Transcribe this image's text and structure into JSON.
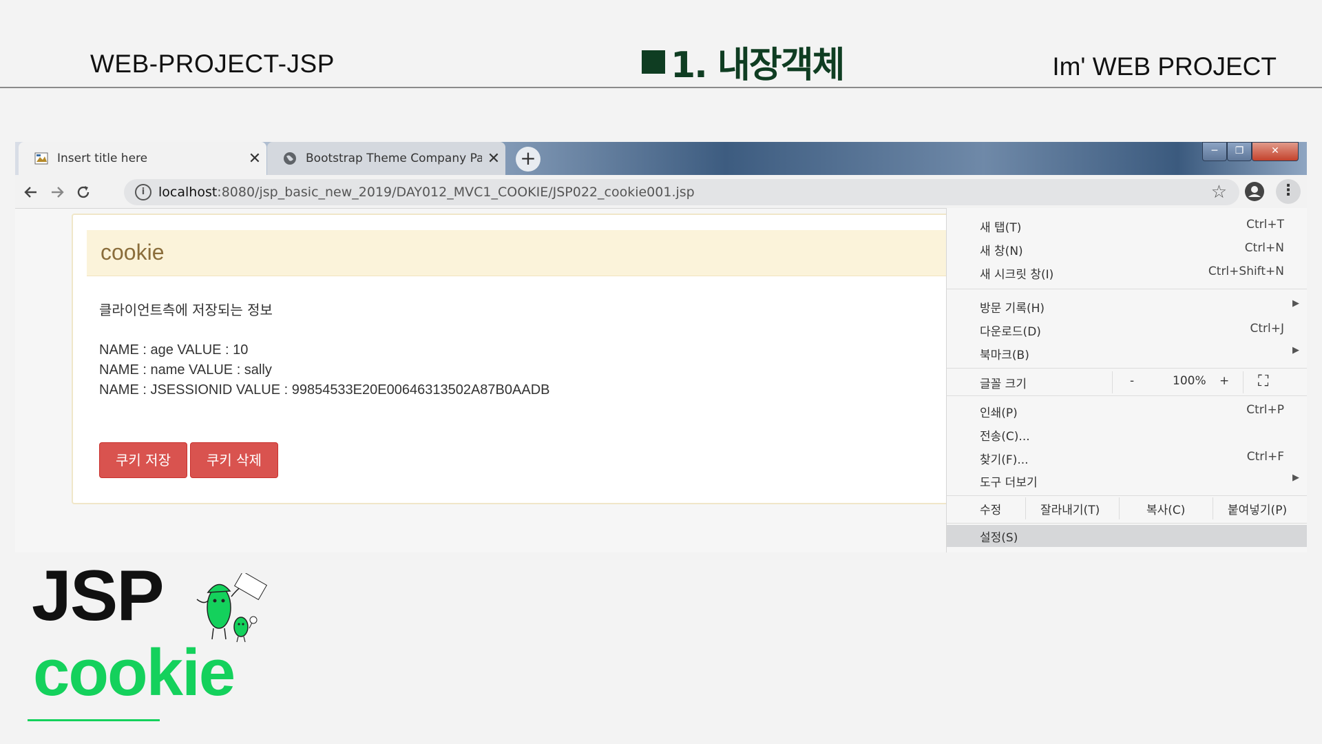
{
  "slide": {
    "left_title": "WEB-PROJECT-JSP",
    "center_title": "1. 내장객체",
    "right_title": "Im' WEB PROJECT",
    "big_word": "JSP",
    "big_word_2": "cookie",
    "accent_color": "#14d15c",
    "title_color": "#0f3d22"
  },
  "browser": {
    "tabs": [
      {
        "title": "Insert title here",
        "close": "✕",
        "icon": "page-icon"
      },
      {
        "title": "Bootstrap Theme Company Pag",
        "close": "✕",
        "icon": "globe-icon"
      }
    ],
    "new_tab": "+",
    "window_controls": [
      "─",
      "❐",
      "✕"
    ],
    "url_host": "localhost",
    "url_path": ":8080/jsp_basic_new_2019/DAY012_MVC1_COOKIE/JSP022_cookie001.jsp",
    "info_icon": "i",
    "star": "☆"
  },
  "page": {
    "heading": "cookie",
    "description": "클라이언트측에 저장되는 정보",
    "cookies": [
      "NAME : age VALUE : 10",
      "NAME : name VALUE : sally",
      "NAME : JSESSIONID VALUE : 99854533E20E00646313502A87B0AADB"
    ],
    "buttons": {
      "save": "쿠키 저장",
      "delete": "쿠키 삭제"
    },
    "button_color": "#d9534f"
  },
  "menu": {
    "items": [
      {
        "label": "새 탭(T)",
        "shortcut": "Ctrl+T"
      },
      {
        "label": "새 창(N)",
        "shortcut": "Ctrl+N"
      },
      {
        "label": "새 시크릿 창(I)",
        "shortcut": "Ctrl+Shift+N"
      },
      {
        "label": "방문 기록(H)",
        "shortcut": ""
      },
      {
        "label": "다운로드(D)",
        "shortcut": "Ctrl+J"
      },
      {
        "label": "북마크(B)",
        "shortcut": ""
      },
      {
        "label": "인쇄(P)",
        "shortcut": "Ctrl+P"
      },
      {
        "label": "전송(C)...",
        "shortcut": ""
      },
      {
        "label": "찾기(F)...",
        "shortcut": "Ctrl+F"
      },
      {
        "label": "도구 더보기",
        "shortcut": ""
      },
      {
        "label": "설정(S)",
        "shortcut": ""
      }
    ],
    "zoom": {
      "label": "글꼴 크기",
      "minus": "-",
      "value": "100%",
      "plus": "+"
    },
    "edit": {
      "label": "수정",
      "cut": "잘라내기(T)",
      "copy": "복사(C)",
      "paste": "붙여넣기(P)"
    }
  }
}
